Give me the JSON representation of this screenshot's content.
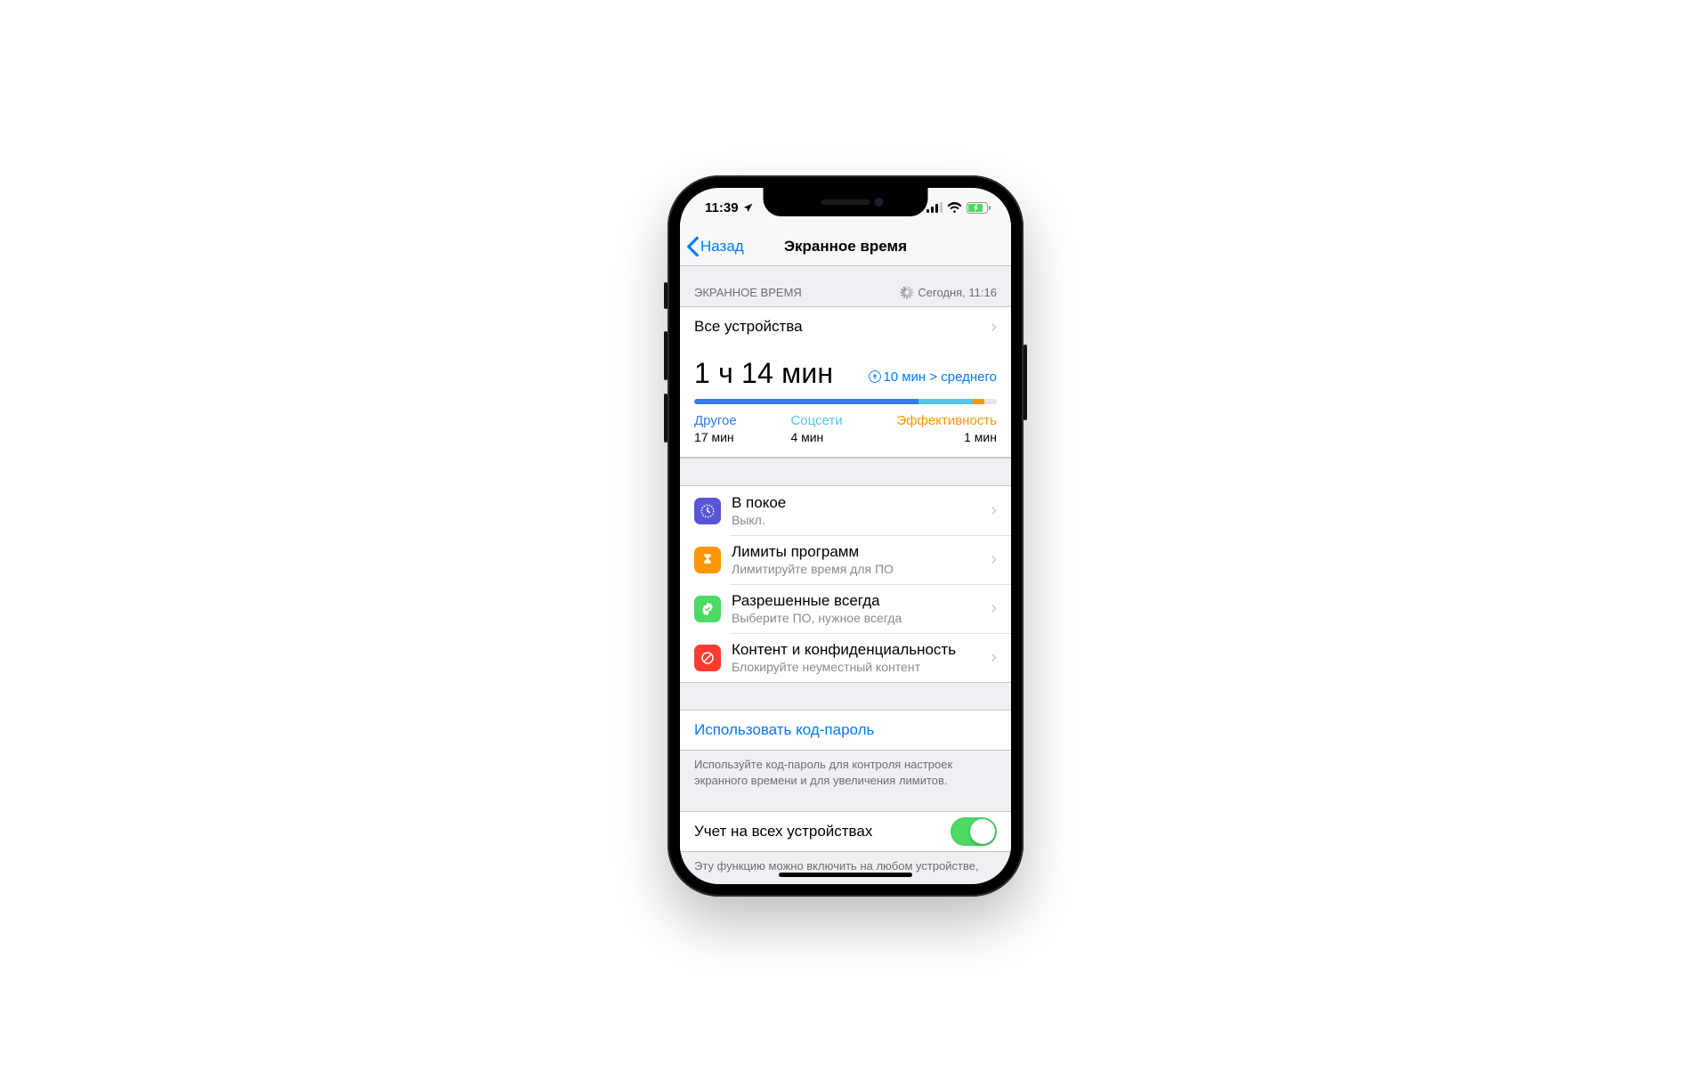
{
  "status": {
    "time": "11:39",
    "location_icon": "location-arrow-icon"
  },
  "nav": {
    "back": "Назад",
    "title": "Экранное время"
  },
  "header": {
    "label": "ЭКРАННОЕ ВРЕМЯ",
    "refresh": "Сегодня, 11:16"
  },
  "devices_row": {
    "title": "Все устройства"
  },
  "summary": {
    "big_time": "1 ч 14 мин",
    "avg_text": "10 мин > среднего",
    "bar": {
      "other_pct": 74,
      "social_pct": 18,
      "productivity_pct": 4
    },
    "categories": [
      {
        "name": "Другое",
        "time": "17 мин",
        "color": "#2f7cf6"
      },
      {
        "name": "Соцсети",
        "time": "4 мин",
        "color": "#54c7ec"
      },
      {
        "name": "Эффективность",
        "time": "1 мин",
        "color": "#ff9500"
      }
    ]
  },
  "options": [
    {
      "title": "В покое",
      "subtitle": "Выкл.",
      "color": "#5856d6",
      "icon": "downtime"
    },
    {
      "title": "Лимиты программ",
      "subtitle": "Лимитируйте время для ПО",
      "color": "#ff9500",
      "icon": "applimits"
    },
    {
      "title": "Разрешенные всегда",
      "subtitle": "Выберите ПО, нужное всегда",
      "color": "#4cd964",
      "icon": "allowed"
    },
    {
      "title": "Контент и конфиденциальность",
      "subtitle": "Блокируйте неуместный контент",
      "color": "#ff3b30",
      "icon": "restrict"
    }
  ],
  "passcode": {
    "label": "Использовать код-пароль",
    "footer": "Используйте код-пароль для контроля настроек экранного времени и для увеличения лимитов."
  },
  "share": {
    "label": "Учет на всех устройствах",
    "on": true,
    "footer": "Эту функцию можно включить на любом устройстве,"
  },
  "chart_data": {
    "type": "bar",
    "title": "Экранное время",
    "total": "1 ч 14 мин",
    "comparison": "+10 мин от среднего",
    "series": [
      {
        "name": "Другое",
        "value_minutes": 17,
        "color": "#2f7cf6"
      },
      {
        "name": "Соцсети",
        "value_minutes": 4,
        "color": "#54c7ec"
      },
      {
        "name": "Эффективность",
        "value_minutes": 1,
        "color": "#ff9500"
      }
    ]
  }
}
